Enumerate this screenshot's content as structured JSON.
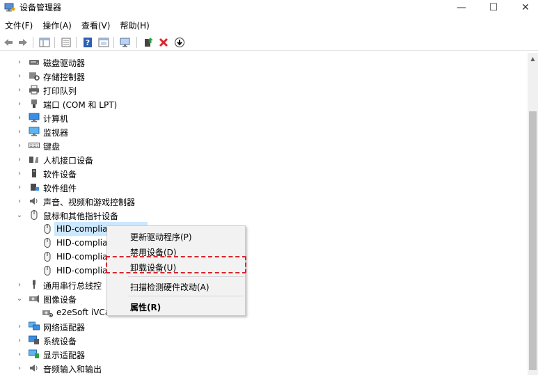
{
  "window": {
    "title": "设备管理器",
    "minimize_glyph": "—",
    "maximize_glyph": "☐",
    "close_glyph": "✕"
  },
  "menu": [
    "文件(F)",
    "操作(A)",
    "查看(V)",
    "帮助(H)"
  ],
  "toolbar": {
    "back_icon": "back-arrow-icon",
    "forward_icon": "forward-arrow-icon",
    "properties_icon": "properties-icon",
    "update_icon": "update-driver-icon",
    "uninstall_icon": "uninstall-x-icon",
    "scan_icon": "scan-download-icon",
    "colors": {
      "uninstall": "#d9262c",
      "update": "#2e9e3f",
      "help": "#2b5fb4"
    }
  },
  "tree": {
    "rows": [
      {
        "label": "磁盘驱动器",
        "expanded": false,
        "level": 0,
        "icon": "disk-icon"
      },
      {
        "label": "存储控制器",
        "expanded": false,
        "level": 0,
        "icon": "storage-icon"
      },
      {
        "label": "打印队列",
        "expanded": false,
        "level": 0,
        "icon": "printer-icon"
      },
      {
        "label": "端口 (COM 和 LPT)",
        "expanded": false,
        "level": 0,
        "icon": "port-icon"
      },
      {
        "label": "计算机",
        "expanded": false,
        "level": 0,
        "icon": "computer-icon"
      },
      {
        "label": "监视器",
        "expanded": false,
        "level": 0,
        "icon": "monitor-icon"
      },
      {
        "label": "键盘",
        "expanded": false,
        "level": 0,
        "icon": "keyboard-icon"
      },
      {
        "label": "人机接口设备",
        "expanded": false,
        "level": 0,
        "icon": "hid-icon"
      },
      {
        "label": "软件设备",
        "expanded": false,
        "level": 0,
        "icon": "software-device-icon"
      },
      {
        "label": "软件组件",
        "expanded": false,
        "level": 0,
        "icon": "software-component-icon"
      },
      {
        "label": "声音、视频和游戏控制器",
        "expanded": false,
        "level": 0,
        "icon": "sound-icon"
      },
      {
        "label": "鼠标和其他指针设备",
        "expanded": true,
        "level": 0,
        "icon": "mouse-icon"
      },
      {
        "label": "HID-complia",
        "level": 1,
        "icon": "mouse-icon",
        "selected": true
      },
      {
        "label": "HID-complia",
        "level": 1,
        "icon": "mouse-icon"
      },
      {
        "label": "HID-complia",
        "level": 1,
        "icon": "mouse-icon"
      },
      {
        "label": "HID-complia",
        "level": 1,
        "icon": "mouse-icon"
      },
      {
        "label": "通用串行总线控",
        "expanded": false,
        "level": 0,
        "icon": "usb-icon"
      },
      {
        "label": "图像设备",
        "expanded": true,
        "level": 0,
        "icon": "camera-icon"
      },
      {
        "label": "e2eSoft iVCa",
        "level": 1,
        "icon": "camera-icon"
      },
      {
        "label": "网络适配器",
        "expanded": false,
        "level": 0,
        "icon": "network-icon"
      },
      {
        "label": "系统设备",
        "expanded": false,
        "level": 0,
        "icon": "system-icon"
      },
      {
        "label": "显示适配器",
        "expanded": false,
        "level": 0,
        "icon": "display-adapter-icon"
      },
      {
        "label": "音频输入和输出",
        "expanded": false,
        "level": 0,
        "icon": "audio-icon"
      }
    ]
  },
  "context_menu": {
    "items": [
      {
        "label": "更新驱动程序(P)",
        "bold": false
      },
      {
        "label": "禁用设备(D)",
        "bold": false
      },
      {
        "label": "卸载设备(U)",
        "bold": false,
        "highlighted": true
      },
      {
        "label": "扫描检测硬件改动(A)",
        "bold": false
      },
      {
        "label": "属性(R)",
        "bold": true
      }
    ]
  }
}
